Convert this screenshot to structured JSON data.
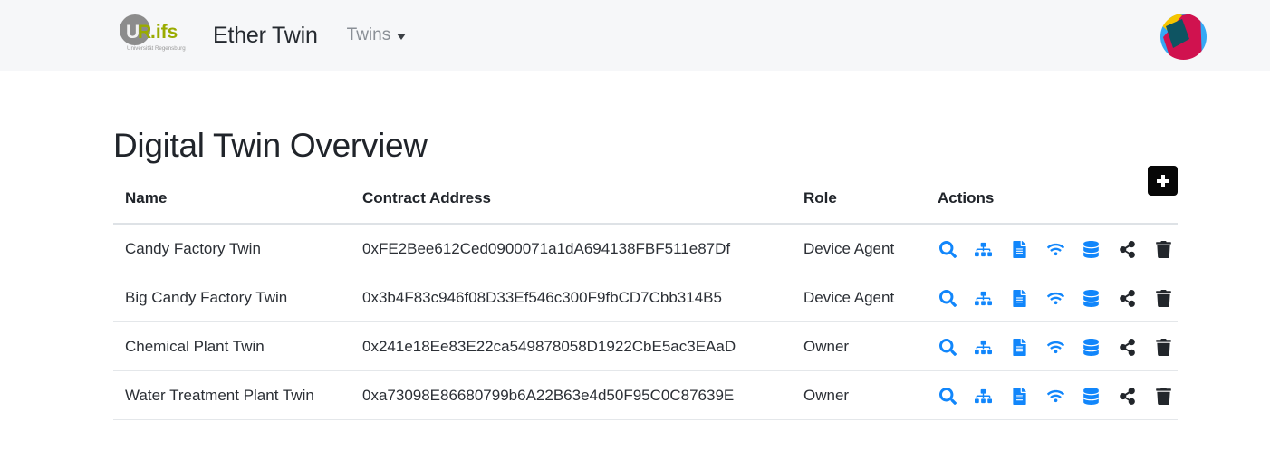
{
  "navbar": {
    "logo": {
      "name": "ur-ifs-logo",
      "text_primary": "UR",
      "text_accent": ".ifs",
      "subtitle": "Universität Regensburg",
      "circle_color": "#8c8c8c",
      "accent_color": "#9aab00"
    },
    "brand_title": "Ether Twin",
    "nav_items": [
      {
        "label": "Twins",
        "has_caret": true
      }
    ],
    "avatar": {
      "name": "user-avatar-logo",
      "colors": [
        "#d0124f",
        "#0e5462",
        "#f5c500",
        "#35a9f5"
      ]
    },
    "background_color": "#f6f7f9"
  },
  "main": {
    "page_title": "Digital Twin Overview",
    "add_button": {
      "label": "+",
      "icon": "plus-icon",
      "background_color": "#070707"
    },
    "table": {
      "columns": [
        "Name",
        "Contract Address",
        "Role",
        "Actions"
      ],
      "rows": [
        {
          "name": "Candy Factory Twin",
          "address": "0xFE2Bee612Ced0900071a1dA694138FBF511e87Df",
          "role": "Device Agent"
        },
        {
          "name": "Big Candy Factory Twin",
          "address": "0x3b4F83c946f08D33Ef546c300F9fbCD7Cbb314B5",
          "role": "Device Agent"
        },
        {
          "name": "Chemical Plant Twin",
          "address": "0x241e18Ee83E22ca549878058D1922CbE5ac3EAaD",
          "role": "Owner"
        },
        {
          "name": "Water Treatment Plant Twin",
          "address": "0xa73098E86680799b6A22B63e4d50F95C0C87639E",
          "role": "Owner"
        }
      ],
      "action_icons": [
        {
          "icon": "search-icon",
          "color": "#1186fb"
        },
        {
          "icon": "sitemap-icon",
          "color": "#1186fb"
        },
        {
          "icon": "file-icon",
          "color": "#1186fb"
        },
        {
          "icon": "wifi-icon",
          "color": "#1186fb"
        },
        {
          "icon": "database-icon",
          "color": "#1186fb"
        },
        {
          "icon": "share-icon",
          "color": "#22262b"
        },
        {
          "icon": "trash-icon",
          "color": "#22262b"
        }
      ]
    }
  }
}
